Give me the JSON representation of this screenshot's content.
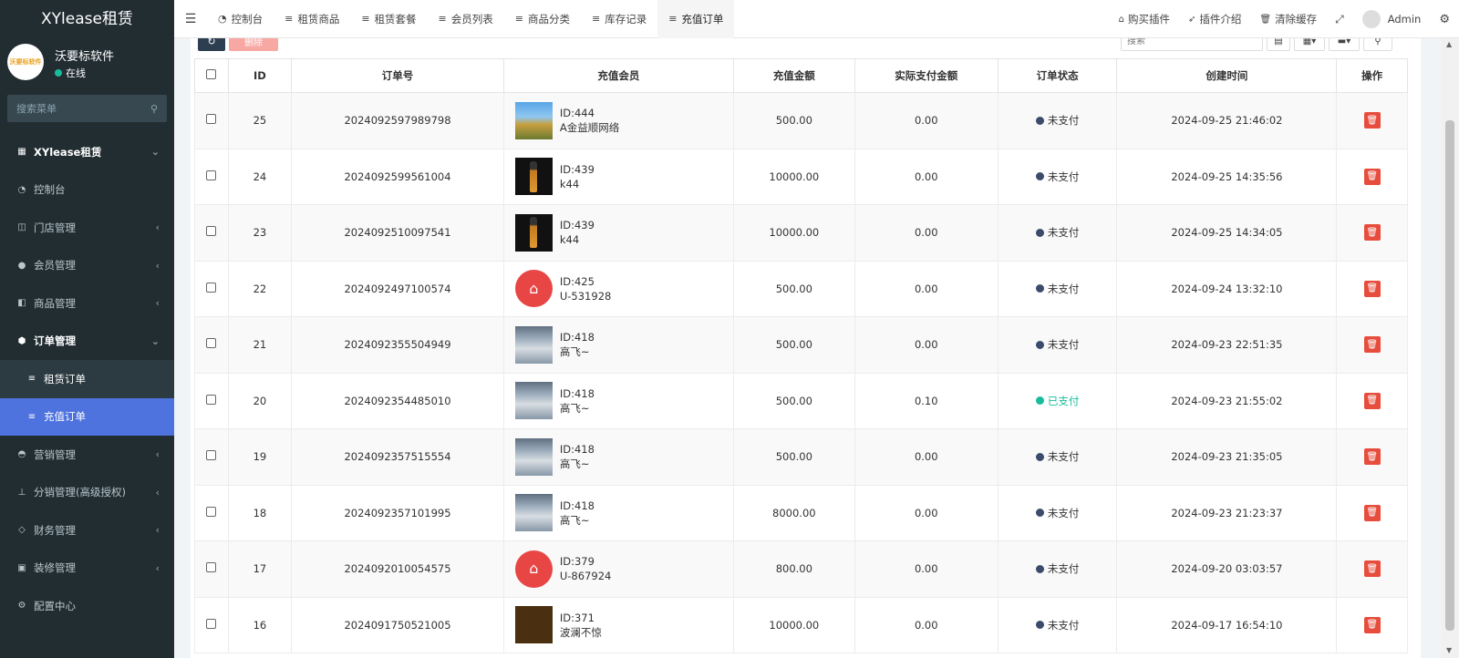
{
  "brand": "XYlease租赁",
  "user": {
    "name": "沃要标软件",
    "status": "在线",
    "logo_text": "沃要标软件"
  },
  "sidebar_search": {
    "placeholder": "搜索菜单"
  },
  "menu": [
    {
      "label": "XYlease租赁",
      "icon": "grid-icon",
      "type": "header",
      "chevron": "⌄"
    },
    {
      "label": "控制台",
      "icon": "dashboard-icon",
      "type": "item",
      "chevron": ""
    },
    {
      "label": "门店管理",
      "icon": "store-icon",
      "type": "item",
      "chevron": "‹"
    },
    {
      "label": "会员管理",
      "icon": "user-icon",
      "type": "item",
      "chevron": "‹"
    },
    {
      "label": "商品管理",
      "icon": "goods-icon",
      "type": "item",
      "chevron": "‹"
    },
    {
      "label": "订单管理",
      "icon": "cube-icon",
      "type": "open",
      "chevron": "⌄"
    },
    {
      "label": "租赁订单",
      "icon": "list-icon",
      "type": "sub",
      "chevron": ""
    },
    {
      "label": "充值订单",
      "icon": "list-icon",
      "type": "active",
      "chevron": ""
    },
    {
      "label": "营销管理",
      "icon": "marketing-icon",
      "type": "item",
      "chevron": "‹"
    },
    {
      "label": "分销管理(高级授权)",
      "icon": "sitemap-icon",
      "type": "item",
      "chevron": "‹"
    },
    {
      "label": "财务管理",
      "icon": "diamond-icon",
      "type": "item",
      "chevron": "‹"
    },
    {
      "label": "装修管理",
      "icon": "image-icon",
      "type": "item",
      "chevron": "‹"
    },
    {
      "label": "配置中心",
      "icon": "gear-icon",
      "type": "item",
      "chevron": ""
    }
  ],
  "tabs": [
    {
      "label": "控制台",
      "icon": "dashboard-icon",
      "active": false
    },
    {
      "label": "租赁商品",
      "icon": "list-icon",
      "active": false
    },
    {
      "label": "租赁套餐",
      "icon": "list-icon",
      "active": false
    },
    {
      "label": "会员列表",
      "icon": "list-icon",
      "active": false
    },
    {
      "label": "商品分类",
      "icon": "list-icon",
      "active": false
    },
    {
      "label": "库存记录",
      "icon": "list-icon",
      "active": false
    },
    {
      "label": "充值订单",
      "icon": "list-icon",
      "active": true
    }
  ],
  "topright": {
    "buy_plugin": "购买插件",
    "plugin_intro": "插件介绍",
    "clear_cache": "清除缓存",
    "admin": "Admin"
  },
  "toolbar": {
    "delete_label": "删除",
    "search_placeholder": "搜索"
  },
  "table": {
    "headers": [
      "ID",
      "订单号",
      "充值会员",
      "充值金额",
      "实际支付金额",
      "订单状态",
      "创建时间",
      "操作"
    ],
    "rows": [
      {
        "id": "25",
        "order_no": "2024092597989798",
        "member_id": "ID:444",
        "member_name": "A金益顺网络",
        "avatar": "landscape",
        "amount": "500.00",
        "paid": "0.00",
        "status": "未支付",
        "paid_flag": false,
        "created": "2024-09-25 21:46:02"
      },
      {
        "id": "24",
        "order_no": "2024092599561004",
        "member_id": "ID:439",
        "member_name": "k44",
        "avatar": "bottle",
        "amount": "10000.00",
        "paid": "0.00",
        "status": "未支付",
        "paid_flag": false,
        "created": "2024-09-25 14:35:56"
      },
      {
        "id": "23",
        "order_no": "2024092510097541",
        "member_id": "ID:439",
        "member_name": "k44",
        "avatar": "bottle",
        "amount": "10000.00",
        "paid": "0.00",
        "status": "未支付",
        "paid_flag": false,
        "created": "2024-09-25 14:34:05"
      },
      {
        "id": "22",
        "order_no": "2024092497100574",
        "member_id": "ID:425",
        "member_name": "U-531928",
        "avatar": "xylease",
        "amount": "500.00",
        "paid": "0.00",
        "status": "未支付",
        "paid_flag": false,
        "created": "2024-09-24 13:32:10"
      },
      {
        "id": "21",
        "order_no": "2024092355504949",
        "member_id": "ID:418",
        "member_name": "高飞~",
        "avatar": "cat",
        "amount": "500.00",
        "paid": "0.00",
        "status": "未支付",
        "paid_flag": false,
        "created": "2024-09-23 22:51:35"
      },
      {
        "id": "20",
        "order_no": "2024092354485010",
        "member_id": "ID:418",
        "member_name": "高飞~",
        "avatar": "cat",
        "amount": "500.00",
        "paid": "0.10",
        "status": "已支付",
        "paid_flag": true,
        "created": "2024-09-23 21:55:02"
      },
      {
        "id": "19",
        "order_no": "2024092357515554",
        "member_id": "ID:418",
        "member_name": "高飞~",
        "avatar": "cat",
        "amount": "500.00",
        "paid": "0.00",
        "status": "未支付",
        "paid_flag": false,
        "created": "2024-09-23 21:35:05"
      },
      {
        "id": "18",
        "order_no": "2024092357101995",
        "member_id": "ID:418",
        "member_name": "高飞~",
        "avatar": "cat",
        "amount": "8000.00",
        "paid": "0.00",
        "status": "未支付",
        "paid_flag": false,
        "created": "2024-09-23 21:23:37"
      },
      {
        "id": "17",
        "order_no": "2024092010054575",
        "member_id": "ID:379",
        "member_name": "U-867924",
        "avatar": "xylease",
        "amount": "800.00",
        "paid": "0.00",
        "status": "未支付",
        "paid_flag": false,
        "created": "2024-09-20 03:03:57"
      },
      {
        "id": "16",
        "order_no": "2024091750521005",
        "member_id": "ID:371",
        "member_name": "波澜不惊",
        "avatar": "sign",
        "amount": "10000.00",
        "paid": "0.00",
        "status": "未支付",
        "paid_flag": false,
        "created": "2024-09-17 16:54:10"
      }
    ]
  },
  "colors": {
    "sidebar_bg": "#222d32",
    "active_menu": "#4e73df",
    "unpaid": "#3c4a6b",
    "paid": "#18bc9c",
    "danger": "#e74c3c"
  }
}
